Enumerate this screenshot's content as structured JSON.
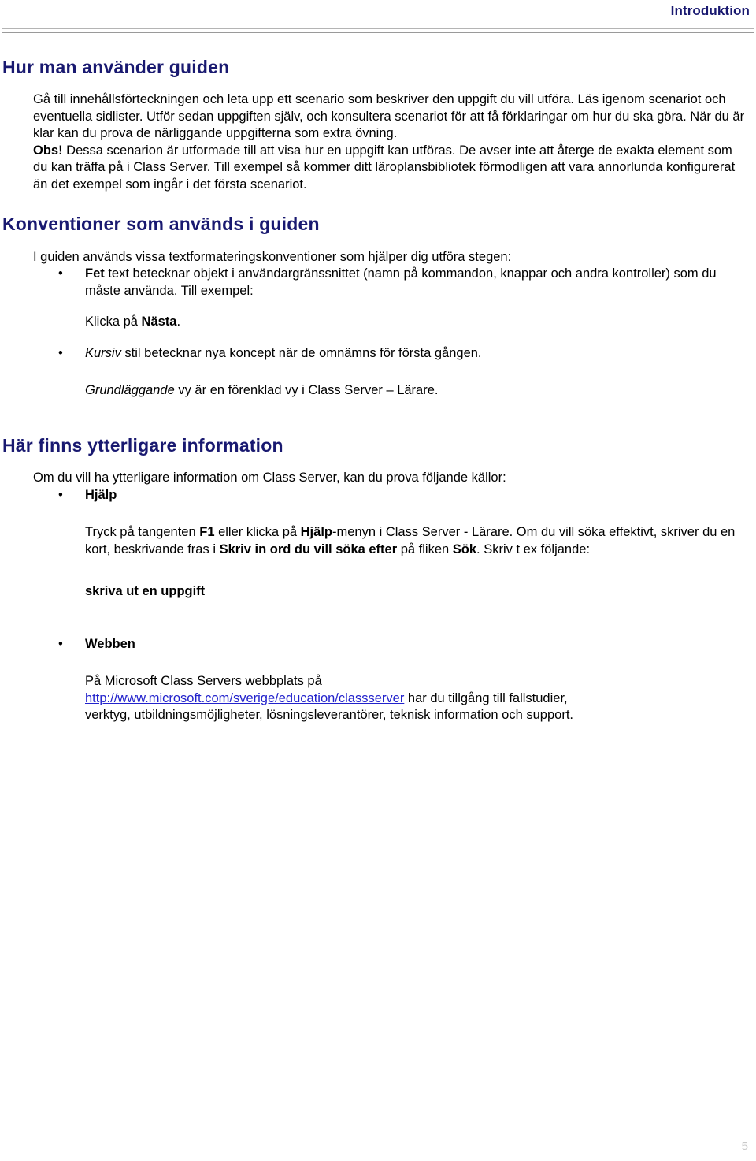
{
  "header": {
    "title": "Introduktion"
  },
  "sections": [
    {
      "heading": "Hur man använder guiden",
      "paragraphs": [
        {
          "id": "p1",
          "text": "Gå till innehållsförteckningen och leta upp ett scenario som beskriver den uppgift du vill utföra. Läs igenom scenariot och eventuella sidlister. Utför sedan uppgiften själv, och konsultera scenariot för att få förklaringar om hur du ska göra. När du är klar kan du prova de närliggande uppgifterna som extra övning."
        },
        {
          "id": "p2",
          "lead_bold": "Obs!",
          "text": " Dessa scenarion är utformade till att visa hur en uppgift kan utföras. De avser inte att återge de exakta element som du kan träffa på i Class Server. Till exempel så kommer ditt läroplansbibliotek förmodligen att vara annorlunda konfigurerat än det exempel som ingår i det första scenariot."
        }
      ]
    },
    {
      "heading": "Konventioner som används i guiden",
      "intro": "I guiden används vissa textformateringskonventioner som hjälper dig utföra stegen:",
      "bullet_1": {
        "bold_lead": "Fet",
        "rest": " text betecknar objekt i användargränssnittet (namn på kommandon, knappar och andra kontroller) som du måste använda. Till exempel:"
      },
      "bullet_1_example": {
        "plain": "Klicka på ",
        "bold": "Nästa",
        "tail": "."
      },
      "bullet_2": {
        "italic_lead": "Kursiv",
        "rest": " stil betecknar nya koncept när de omnämns för första gången."
      },
      "bullet_2_example": {
        "italic": "Grundläggande",
        "rest": " vy är en förenklad vy i Class Server – Lärare."
      }
    },
    {
      "heading": "Här finns ytterligare information",
      "intro": "Om du vill ha ytterligare information om Class Server, kan du prova följande källor:",
      "source_1": {
        "label": "Hjälp",
        "para_parts": {
          "t1": "Tryck på tangenten ",
          "b1": "F1",
          "t2": " eller klicka på ",
          "b2": "Hjälp",
          "t3": "-menyn i Class Server - Lärare. Om du vill söka effektivt, skriver du en kort, beskrivande fras i ",
          "b3": "Skriv in ord du vill söka efter",
          "t4": " på fliken ",
          "b4": "Sök",
          "t5": ". Skriv t ex följande:"
        },
        "example": "skriva ut en uppgift"
      },
      "source_2": {
        "label": "Webben",
        "para_lead": "På Microsoft Class Servers webbplats på",
        "link_text": "http://www.microsoft.com/sverige/education/classserver",
        "para_tail_1": " har du tillgång till fallstudier,",
        "para_tail_2": "verktyg, utbildningsmöjligheter, lösningsleverantörer, teknisk information och support."
      }
    }
  ],
  "footer": {
    "page_number": "5"
  },
  "colors": {
    "heading_blue": "#191970",
    "link_blue": "#2222cc",
    "rule_gray": "#b4b4b4",
    "page_number_gray": "#c9c9c9"
  },
  "icons": {
    "bullet_glyph": "•"
  }
}
